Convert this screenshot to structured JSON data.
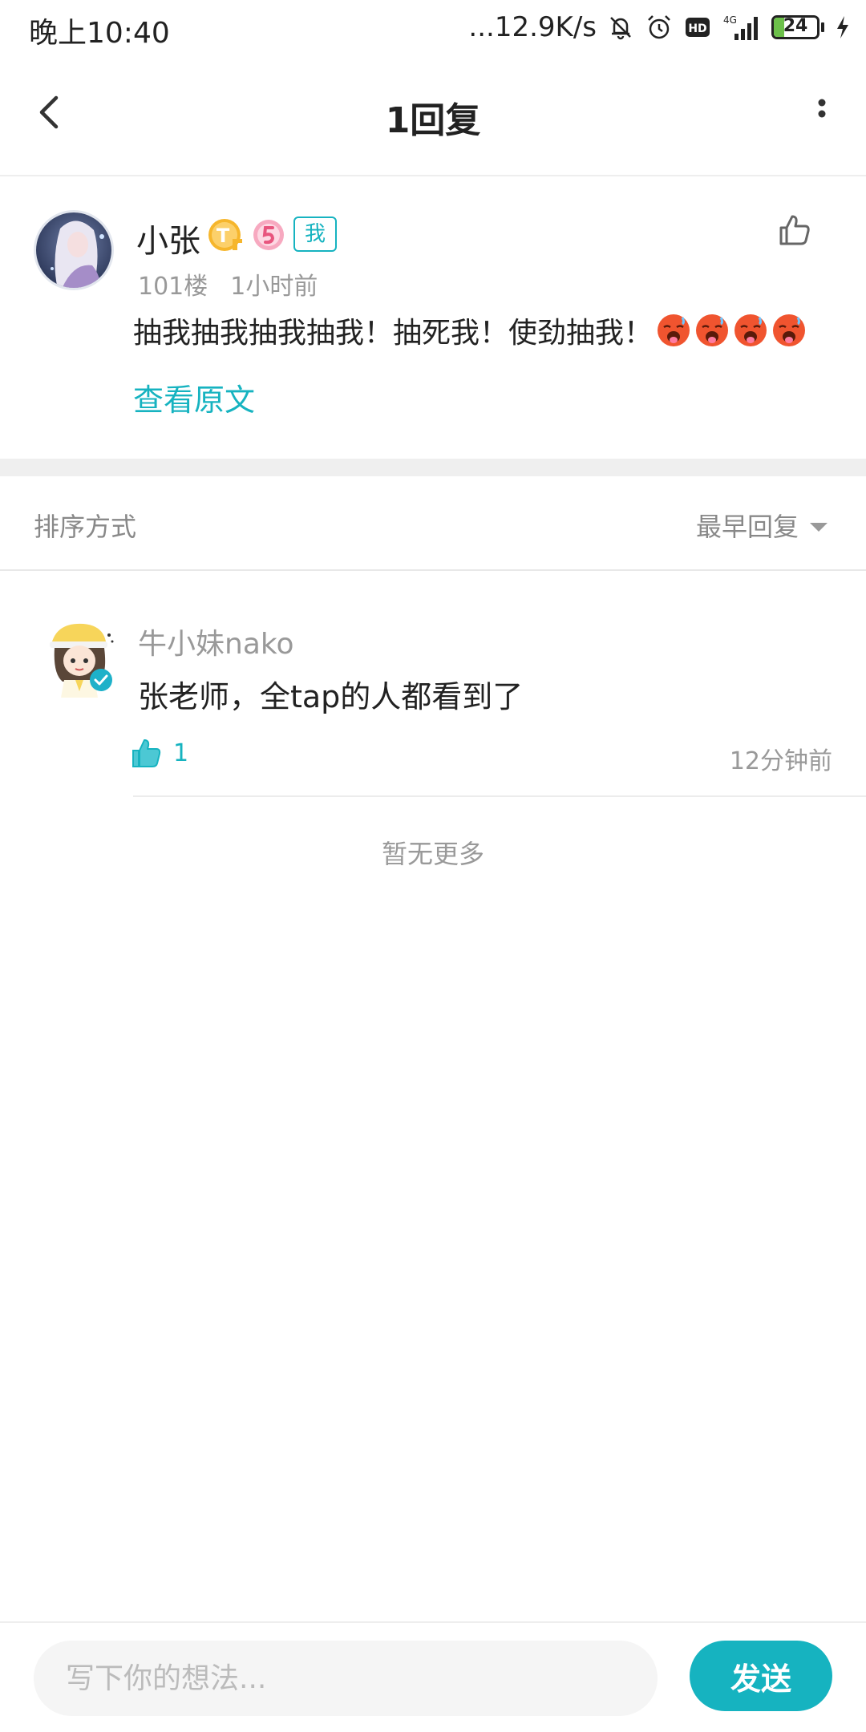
{
  "status_bar": {
    "time": "晚上10:40",
    "net_speed": "...12.9K/s",
    "hd_label": "HD",
    "network_type": "4G",
    "battery_level": 24,
    "battery_text": "24"
  },
  "nav": {
    "title": "1回复",
    "back_icon": "chevron-left-icon",
    "more_icon": "more-vertical-icon"
  },
  "post": {
    "author": "小张",
    "badges": [
      "t-level-icon",
      "level-5-icon"
    ],
    "tag": "我",
    "floor": "101楼",
    "time": "1小时前",
    "content": "抽我抽我抽我抽我！抽死我！使劲抽我！",
    "emoji_icons": [
      "hot-face-emoji",
      "hot-face-emoji",
      "hot-face-emoji",
      "hot-face-emoji"
    ],
    "view_original": "查看原文"
  },
  "sort": {
    "label": "排序方式",
    "value": "最早回复"
  },
  "replies": [
    {
      "author": "牛小妹nako",
      "text": "张老师，全tap的人都看到了",
      "likes": "1",
      "time": "12分钟前"
    }
  ],
  "footer_text": "暂无更多",
  "composer": {
    "placeholder": "写下你的想法...",
    "send_label": "发送"
  },
  "colors": {
    "accent": "#16b3c0",
    "muted_text": "#999999",
    "primary_text": "#222222"
  }
}
